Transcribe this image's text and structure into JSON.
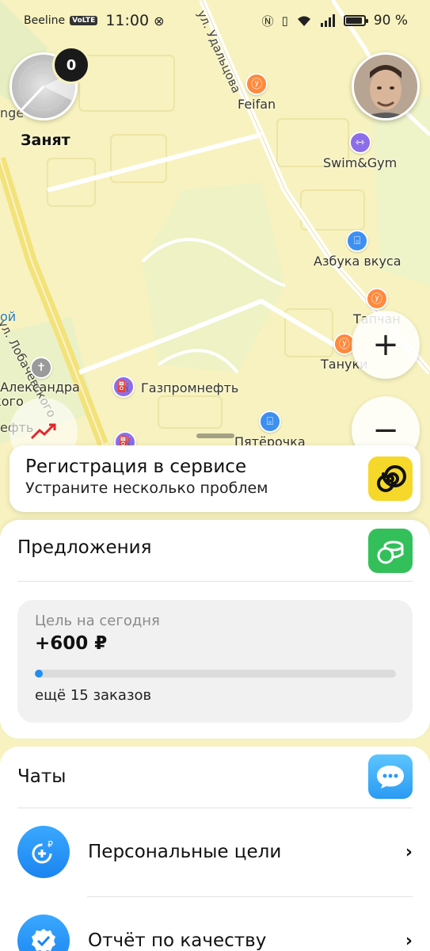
{
  "status_bar": {
    "carrier": "Beeline",
    "volte": "VoLTE",
    "time": "11:00",
    "battery_percent": "90 %",
    "battery_level": 0.9
  },
  "map": {
    "streets": [
      {
        "label": "ул. Лобачевского"
      },
      {
        "label": "ул. Удальцова"
      }
    ],
    "pois": [
      {
        "label": "Feifan",
        "icon": "restaurant-icon",
        "color": "#ff8a3d"
      },
      {
        "label": "Swim&Gym",
        "icon": "fitness-icon",
        "color": "#8d6de8"
      },
      {
        "label": "Азбука вкуса",
        "icon": "basket-icon",
        "color": "#3d8ff0"
      },
      {
        "label": "Тапчан",
        "icon": "restaurant-icon",
        "color": "#ff8a3d"
      },
      {
        "label": "Тануки",
        "icon": "restaurant-icon",
        "color": "#ff8a3d"
      },
      {
        "label": "Газпромнефть",
        "icon": "fuel-icon",
        "color": "#8d6de8"
      },
      {
        "label": "Пятёрочка",
        "icon": "basket-icon",
        "color": "#3d8ff0"
      },
      {
        "label": "Храм Александра Невского",
        "icon": "church-icon",
        "color": "#9a9a9a"
      }
    ],
    "fragments": {
      "left_top": "nge",
      "left_mid": "ой",
      "left_low": "ефть"
    }
  },
  "driver_status": {
    "badge_count": "0",
    "label": "Занят"
  },
  "zoom": {
    "plus": "+",
    "minus": "−"
  },
  "registration": {
    "title": "Регистрация в сервисе",
    "subtitle": "Устраните несколько проблем",
    "accent": "#f5d82a"
  },
  "offers": {
    "title": "Предложения",
    "goal_label": "Цель на сегодня",
    "goal_value": "+600 ₽",
    "goal_progress": 0.02,
    "goal_remaining": "ещё 15 заказов",
    "accent": "#33c05a"
  },
  "menu": {
    "chats": "Чаты",
    "personal_goals": "Персональные цели",
    "quality_report": "Отчёт по качеству"
  }
}
